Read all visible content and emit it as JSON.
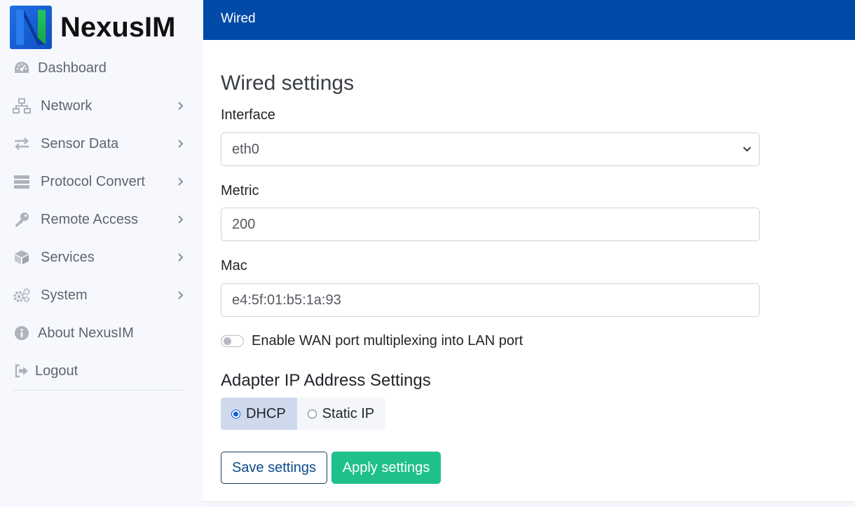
{
  "app": {
    "name": "NexusIM",
    "colors": {
      "brand": "#004ba8",
      "accent": "#20c08a",
      "logo_blue": "#1e6fe3",
      "logo_green": "#22c55e"
    }
  },
  "sidebar": {
    "items": [
      {
        "label": "Dashboard",
        "icon": "dashboard-gauge-icon",
        "submenu": false
      },
      {
        "label": "Network",
        "icon": "network-icon",
        "submenu": true
      },
      {
        "label": "Sensor Data",
        "icon": "exchange-arrows-icon",
        "submenu": true
      },
      {
        "label": "Protocol Convert",
        "icon": "server-stack-icon",
        "submenu": true
      },
      {
        "label": "Remote Access",
        "icon": "key-icon",
        "submenu": true
      },
      {
        "label": "Services",
        "icon": "cube-icon",
        "submenu": true
      },
      {
        "label": "System",
        "icon": "gears-icon",
        "submenu": true
      },
      {
        "label": "About NexusIM",
        "icon": "info-icon",
        "submenu": false
      },
      {
        "label": "Logout",
        "icon": "logout-icon",
        "submenu": false
      }
    ]
  },
  "header": {
    "title": "Wired"
  },
  "form": {
    "title": "Wired settings",
    "interface": {
      "label": "Interface",
      "value": "eth0"
    },
    "metric": {
      "label": "Metric",
      "value": "200"
    },
    "mac": {
      "label": "Mac",
      "value": "e4:5f:01:b5:1a:93"
    },
    "wan_toggle": {
      "label": "Enable WAN port multiplexing into LAN port",
      "checked": false
    },
    "ip_section": {
      "title": "Adapter IP Address Settings",
      "options": [
        {
          "label": "DHCP",
          "checked": true
        },
        {
          "label": "Static IP",
          "checked": false
        }
      ]
    },
    "buttons": {
      "save": "Save settings",
      "apply": "Apply settings"
    }
  }
}
